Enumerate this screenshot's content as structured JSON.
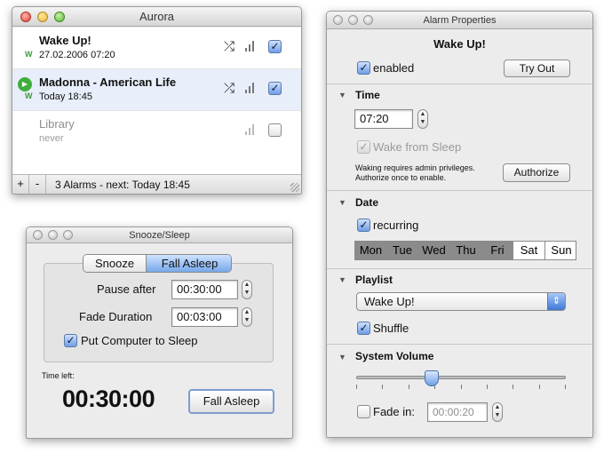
{
  "aurora": {
    "title": "Aurora",
    "alarms": [
      {
        "title": "Wake Up!",
        "sub": "27.02.2006 07:20",
        "badge": "W",
        "checked": "✓"
      },
      {
        "title": "Madonna - American Life",
        "sub": "Today 18:45",
        "badge": "W",
        "checked": "✓"
      },
      {
        "title": "Library",
        "sub": "never",
        "badge": "",
        "checked": ""
      }
    ],
    "add_label": "+",
    "remove_label": "-",
    "status": "3 Alarms - next: Today 18:45"
  },
  "snooze": {
    "title": "Snooze/Sleep",
    "tabs": [
      "Snooze",
      "Fall Asleep"
    ],
    "pause_label": "Pause after",
    "pause_value": "00:30:00",
    "fade_label": "Fade Duration",
    "fade_value": "00:03:00",
    "sleep_label": "Put Computer to Sleep",
    "time_left_label": "Time left:",
    "time_left_value": "00:30:00",
    "fall_asleep_button": "Fall Asleep"
  },
  "props": {
    "title": "Alarm Properties",
    "alarm_name": "Wake Up!",
    "enabled_label": "enabled",
    "try_out_label": "Try Out",
    "time_section": "Time",
    "time_value": "07:20",
    "wake_label": "Wake from Sleep",
    "admin_note_1": "Waking requires admin privileges.",
    "admin_note_2": "Authorize once to enable.",
    "authorize_label": "Authorize",
    "date_section": "Date",
    "recurring_label": "recurring",
    "days": [
      "Mon",
      "Tue",
      "Wed",
      "Thu",
      "Fri",
      "Sat",
      "Sun"
    ],
    "playlist_section": "Playlist",
    "playlist_value": "Wake Up!",
    "shuffle_label": "Shuffle",
    "volume_section": "System Volume",
    "fade_in_label": "Fade in:",
    "fade_in_value": "00:00:20",
    "volume_level": 0.36
  },
  "colors": {
    "selection": "#e8eefa",
    "day_selected": "#8b8b8b",
    "play_green": "#3fae3a"
  },
  "icons": {
    "play": "▶",
    "shuffle": "⤮",
    "check": "✓",
    "triangle_down": "▼",
    "up": "▲",
    "down": "▼",
    "popup_arrows": "⇕"
  }
}
